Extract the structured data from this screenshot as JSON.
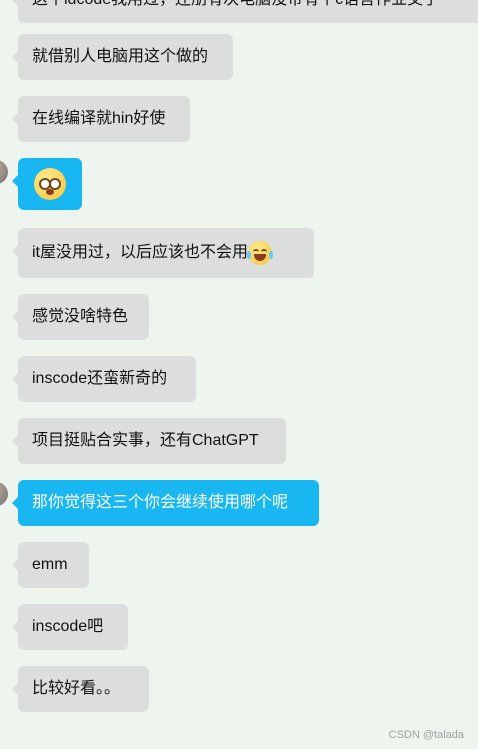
{
  "messages": [
    {
      "text": "这个idcode我用过，还朋有次电脑没带有个c语言作业交了"
    },
    {
      "text": "就借别人电脑用这个做的"
    },
    {
      "text": "在线编译就hin好使"
    },
    {
      "emoji": "astonished-face-icon"
    },
    {
      "text": "it屋没用过，以后应该也不会用",
      "emoji": "laugh-tears-icon"
    },
    {
      "text": "感觉没啥特色"
    },
    {
      "text": "inscode还蛮新奇的"
    },
    {
      "text": "项目挺贴合实事，还有ChatGPT"
    },
    {
      "text": "那你觉得这三个你会继续使用哪个呢"
    },
    {
      "text": "emm"
    },
    {
      "text": "inscode吧"
    },
    {
      "text": "比较好看。。"
    }
  ],
  "footer": {
    "watermark": "CSDN @talada"
  },
  "colors": {
    "background": "#eef5ef",
    "incoming_bubble": "#dcdedd",
    "outgoing_bubble": "#18b7f2"
  }
}
